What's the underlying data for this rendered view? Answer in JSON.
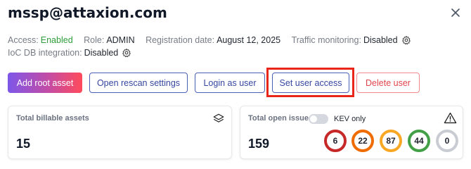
{
  "header": {
    "title": "mssp@attaxion.com"
  },
  "meta": {
    "access_label": "Access:",
    "access_value": "Enabled",
    "role_label": "Role:",
    "role_value": "ADMIN",
    "reg_label": "Registration date:",
    "reg_value": "August 12, 2025",
    "traffic_label": "Traffic monitoring:",
    "traffic_value": "Disabled",
    "ioc_label": "IoC DB integration:",
    "ioc_value": "Disabled"
  },
  "actions": {
    "add_root_asset": "Add root asset",
    "open_rescan_settings": "Open rescan settings",
    "login_as_user": "Login as user",
    "set_user_access": "Set user access",
    "delete_user": "Delete user"
  },
  "cards": {
    "billable": {
      "label": "Total billable assets",
      "value": "15"
    },
    "issues": {
      "label": "Total open issues",
      "kev_label": "KEV only",
      "kev_enabled": false,
      "value": "159",
      "severity": [
        {
          "count": "6",
          "color": "#c62828"
        },
        {
          "count": "22",
          "color": "#ef6c00"
        },
        {
          "count": "87",
          "color": "#f9a825"
        },
        {
          "count": "44",
          "color": "#43a047"
        },
        {
          "count": "0",
          "color": "#c9ccd3"
        }
      ]
    }
  },
  "colors": {
    "accent": "#3546a0",
    "danger": "#e0454c",
    "highlight": "#e8261a"
  }
}
